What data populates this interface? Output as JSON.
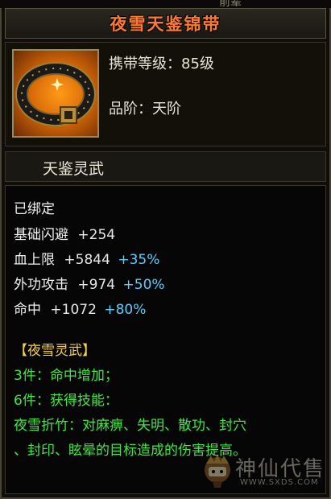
{
  "header": {
    "top_partial_text": "前辈",
    "title": "夜雪天鉴锦带"
  },
  "item": {
    "icon": "belt-icon",
    "level_label": "携带等级：85级",
    "grade_label": "品阶：天阶"
  },
  "subtitle": "天鉴灵武",
  "details": {
    "bound": "已绑定",
    "stats": [
      {
        "name": "基础闪避",
        "value": "+254",
        "pct": ""
      },
      {
        "name": "血上限",
        "value": "+5844",
        "pct": "+35%"
      },
      {
        "name": "外功攻击",
        "value": "+974",
        "pct": "+50%"
      },
      {
        "name": "命中",
        "value": "+1072",
        "pct": "+80%"
      }
    ],
    "set_name": "【夜雪灵武】",
    "set_bonus": [
      "3件：命中增加；",
      "6件：获得技能：",
      "夜雪折竹：对麻痹、失明、散功、封穴",
      "、封印、眩晕的目标造成的伤害提高。"
    ]
  },
  "watermark": {
    "logo_icon": "mascot-logo-icon",
    "text": "神仙代售",
    "url": "WWW.SXDS.COM"
  },
  "colors": {
    "title": "#ff7a2a",
    "percent": "#5ad0ff",
    "set_name": "#f7d23a",
    "set_bonus": "#3ee83e"
  }
}
